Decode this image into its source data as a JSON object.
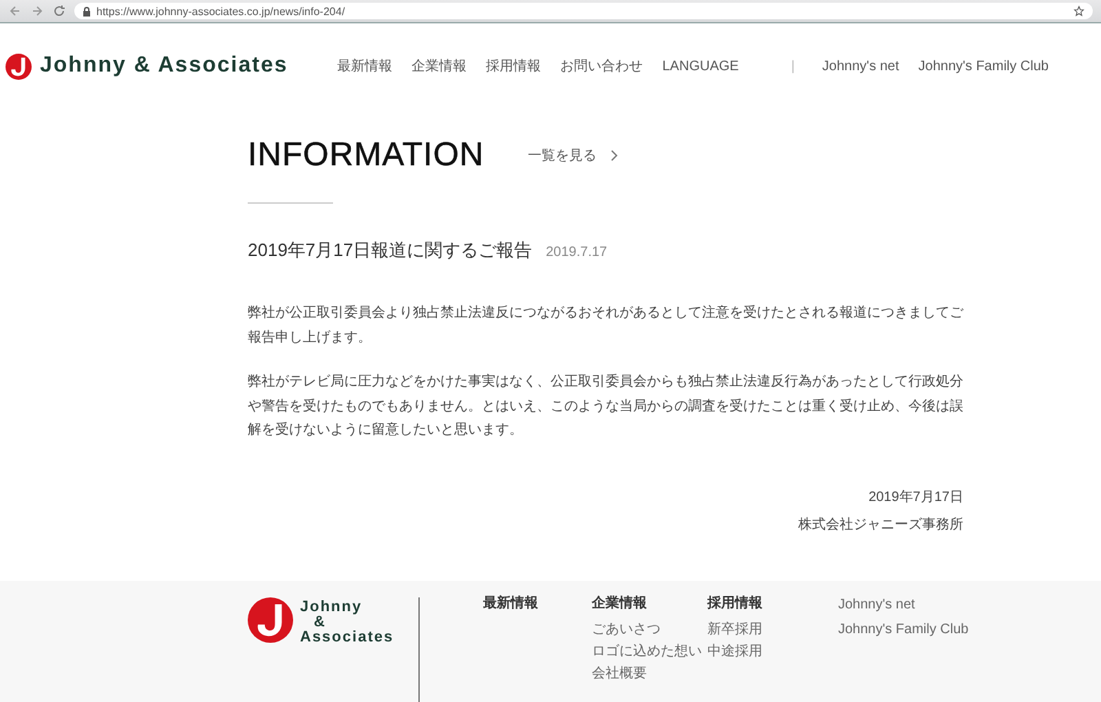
{
  "browser": {
    "url": "https://www.johnny-associates.co.jp/news/info-204/"
  },
  "header": {
    "logo": "Johnny & Associates",
    "nav": [
      "最新情報",
      "企業情報",
      "採用情報",
      "お問い合わせ",
      "LANGUAGE"
    ],
    "separator": "|",
    "external_links": [
      "Johnny's net",
      "Johnny's Family Club"
    ]
  },
  "page": {
    "title": "INFORMATION",
    "list_link": "一覧を見る"
  },
  "article": {
    "title": "2019年7月17日報道に関するご報告",
    "date": "2019.7.17",
    "paragraphs": [
      "弊社が公正取引委員会より独占禁止法違反につながるおそれがあるとして注意を受けたとされる報道につきましてご報告申し上げます。",
      "弊社がテレビ局に圧力などをかけた事実はなく、公正取引委員会からも独占禁止法違反行為があったとして行政処分や警告を受けたものでもありません。とはいえ、このような当局からの調査を受けたことは重く受け止め、今後は誤解を受けないように留意したいと思います。"
    ],
    "signature_date": "2019年7月17日",
    "signature_company": "株式会社ジャニーズ事務所"
  },
  "footer": {
    "logo_lines": [
      "Johnny",
      "&",
      "Associates"
    ],
    "columns": [
      {
        "heading": "最新情報"
      },
      {
        "heading": "企業情報",
        "links": [
          "ごあいさつ",
          "ロゴに込めた想い",
          "会社概要"
        ]
      },
      {
        "heading": "採用情報",
        "links": [
          "新卒採用",
          "中途採用"
        ]
      }
    ],
    "external_links": [
      "Johnny's net",
      "Johnny's Family Club"
    ]
  }
}
